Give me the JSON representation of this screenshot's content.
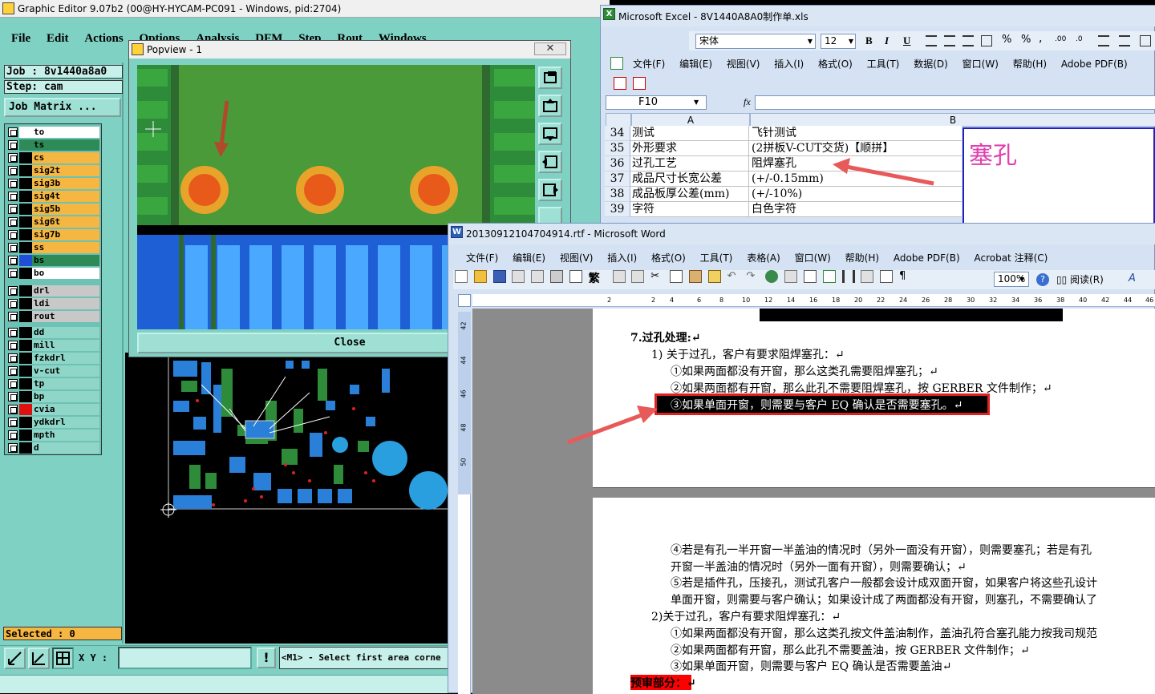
{
  "graphic_editor": {
    "title": "Graphic Editor 9.07b2 (00@HY-HYCAM-PC091 - Windows, pid:2704)",
    "menu": [
      "File",
      "Edit",
      "Actions",
      "Options",
      "Analysis",
      "DFM",
      "Step",
      "Rout",
      "Windows"
    ],
    "job": "Job : 8v1440a8a0",
    "step": "Step: cam",
    "job_matrix": "Job Matrix ...",
    "layers": [
      {
        "name": "to",
        "color": "#ffffff",
        "bg": "#ffffff"
      },
      {
        "name": "ts",
        "color": "#2e8b57",
        "bg": "#2e8b57"
      },
      {
        "name": "cs",
        "color": "#000000",
        "bg": "#f5b642"
      },
      {
        "name": "sig2t",
        "color": "#000000",
        "bg": "#f5b642"
      },
      {
        "name": "sig3b",
        "color": "#000000",
        "bg": "#f5b642"
      },
      {
        "name": "sig4t",
        "color": "#000000",
        "bg": "#f5b642"
      },
      {
        "name": "sig5b",
        "color": "#000000",
        "bg": "#f5b642"
      },
      {
        "name": "sig6t",
        "color": "#000000",
        "bg": "#f5b642"
      },
      {
        "name": "sig7b",
        "color": "#000000",
        "bg": "#f5b642"
      },
      {
        "name": "ss",
        "color": "#000000",
        "bg": "#f5b642"
      },
      {
        "name": "bs",
        "color": "#1e4fd6",
        "bg": "#2e8b57"
      },
      {
        "name": "bo",
        "color": "#000000",
        "bg": "#ffffff"
      },
      {
        "name": "drl",
        "color": "#000000",
        "bg": "#c8c8c8"
      },
      {
        "name": "ldi",
        "color": "#000000",
        "bg": "#c8c8c8"
      },
      {
        "name": "rout",
        "color": "#000000",
        "bg": "#c8c8c8"
      },
      {
        "name": "dd",
        "color": "#000000",
        "bg": "#8fd6c8"
      },
      {
        "name": "mill",
        "color": "#000000",
        "bg": "#8fd6c8"
      },
      {
        "name": "fzkdrl",
        "color": "#000000",
        "bg": "#8fd6c8"
      },
      {
        "name": "v-cut",
        "color": "#000000",
        "bg": "#8fd6c8"
      },
      {
        "name": "tp",
        "color": "#000000",
        "bg": "#8fd6c8"
      },
      {
        "name": "bp",
        "color": "#000000",
        "bg": "#8fd6c8"
      },
      {
        "name": "cvia",
        "color": "#e01010",
        "bg": "#8fd6c8"
      },
      {
        "name": "ydkdrl",
        "color": "#000000",
        "bg": "#8fd6c8"
      },
      {
        "name": "mpth",
        "color": "#000000",
        "bg": "#8fd6c8"
      },
      {
        "name": "d",
        "color": "#000000",
        "bg": "#8fd6c8"
      }
    ],
    "selected": "Selected : 0",
    "xy_label": "X Y :",
    "xy_value": "",
    "status_msg": "<M1> - Select first area corne"
  },
  "popview": {
    "title": "Popview - 1",
    "close": "Close"
  },
  "excel": {
    "title": "Microsoft Excel - 8V1440A8A0制作单.xls",
    "font_name": "宋体",
    "font_size": "12",
    "menu": [
      "文件(F)",
      "编辑(E)",
      "视图(V)",
      "插入(I)",
      "格式(O)",
      "工具(T)",
      "数据(D)",
      "窗口(W)",
      "帮助(H)",
      "Adobe PDF(B)"
    ],
    "cell_ref": "F10",
    "fx": "fx",
    "col_a": "A",
    "col_b": "B",
    "rows": [
      {
        "num": "34",
        "a": "测试",
        "b": "飞针测试"
      },
      {
        "num": "35",
        "a": "外形要求",
        "b": "(2拼板V-CUT交货)【顺拼】"
      },
      {
        "num": "36",
        "a": "过孔工艺",
        "b": "阻焊塞孔"
      },
      {
        "num": "37",
        "a": "成品尺寸长宽公差",
        "b": "(+/-0.15mm)"
      },
      {
        "num": "38",
        "a": "成品板厚公差(mm)",
        "b": "(+/-10%)"
      },
      {
        "num": "39",
        "a": "字符",
        "b": "白色字符"
      }
    ],
    "note": "塞孔"
  },
  "word": {
    "title": "20130912104704914.rtf - Microsoft Word",
    "menu": [
      "文件(F)",
      "编辑(E)",
      "视图(V)",
      "插入(I)",
      "格式(O)",
      "工具(T)",
      "表格(A)",
      "窗口(W)",
      "帮助(H)",
      "Adobe PDF(B)",
      "Acrobat 注释(C)"
    ],
    "zoom": "100%",
    "read_label": "阅读(R)",
    "ruler": [
      "2",
      "2",
      "4",
      "6",
      "8",
      "10",
      "12",
      "14",
      "16",
      "18",
      "20",
      "22",
      "24",
      "26",
      "28",
      "30",
      "32",
      "34",
      "36",
      "38",
      "40",
      "42",
      "44",
      "46"
    ],
    "vruler": [
      "42",
      "44",
      "46",
      "48",
      "50"
    ],
    "lines": [
      "7.过孔处理:↵",
      "1) 关于过孔，客户有要求阻焊塞孔：↵",
      "①如果两面都没有开窗，那么这类孔需要阻焊塞孔；↵",
      "②如果两面都有开窗，那么此孔不需要阻焊塞孔，按 GERBER 文件制作；↵",
      "③如果单面开窗，则需要与客户 EQ 确认是否需要塞孔。↵",
      "④若是有孔一半开窗一半盖油的情况时（另外一面没有开窗），则需要塞孔；若是有孔",
      "开窗一半盖油的情况时（另外一面有开窗），则需要确认；↵",
      "⑤若是插件孔，压接孔，测试孔客户一般都会设计成双面开窗，如果客户将这些孔设计",
      "单面开窗，则需要与客户确认；如果设计成了两面都没有开窗，则塞孔，不需要确认了",
      "2)关于过孔，客户有要求阻焊塞孔：↵",
      "①如果两面都没有开窗，那么这类孔按文件盖油制作，盖油孔符合塞孔能力按我司规范",
      "②如果两面都有开窗，那么此孔不需要盖油，按 GERBER 文件制作；↵",
      "③如果单面开窗，则需要与客户 EQ 确认是否需要盖油↵",
      "预审部分：↵"
    ]
  }
}
